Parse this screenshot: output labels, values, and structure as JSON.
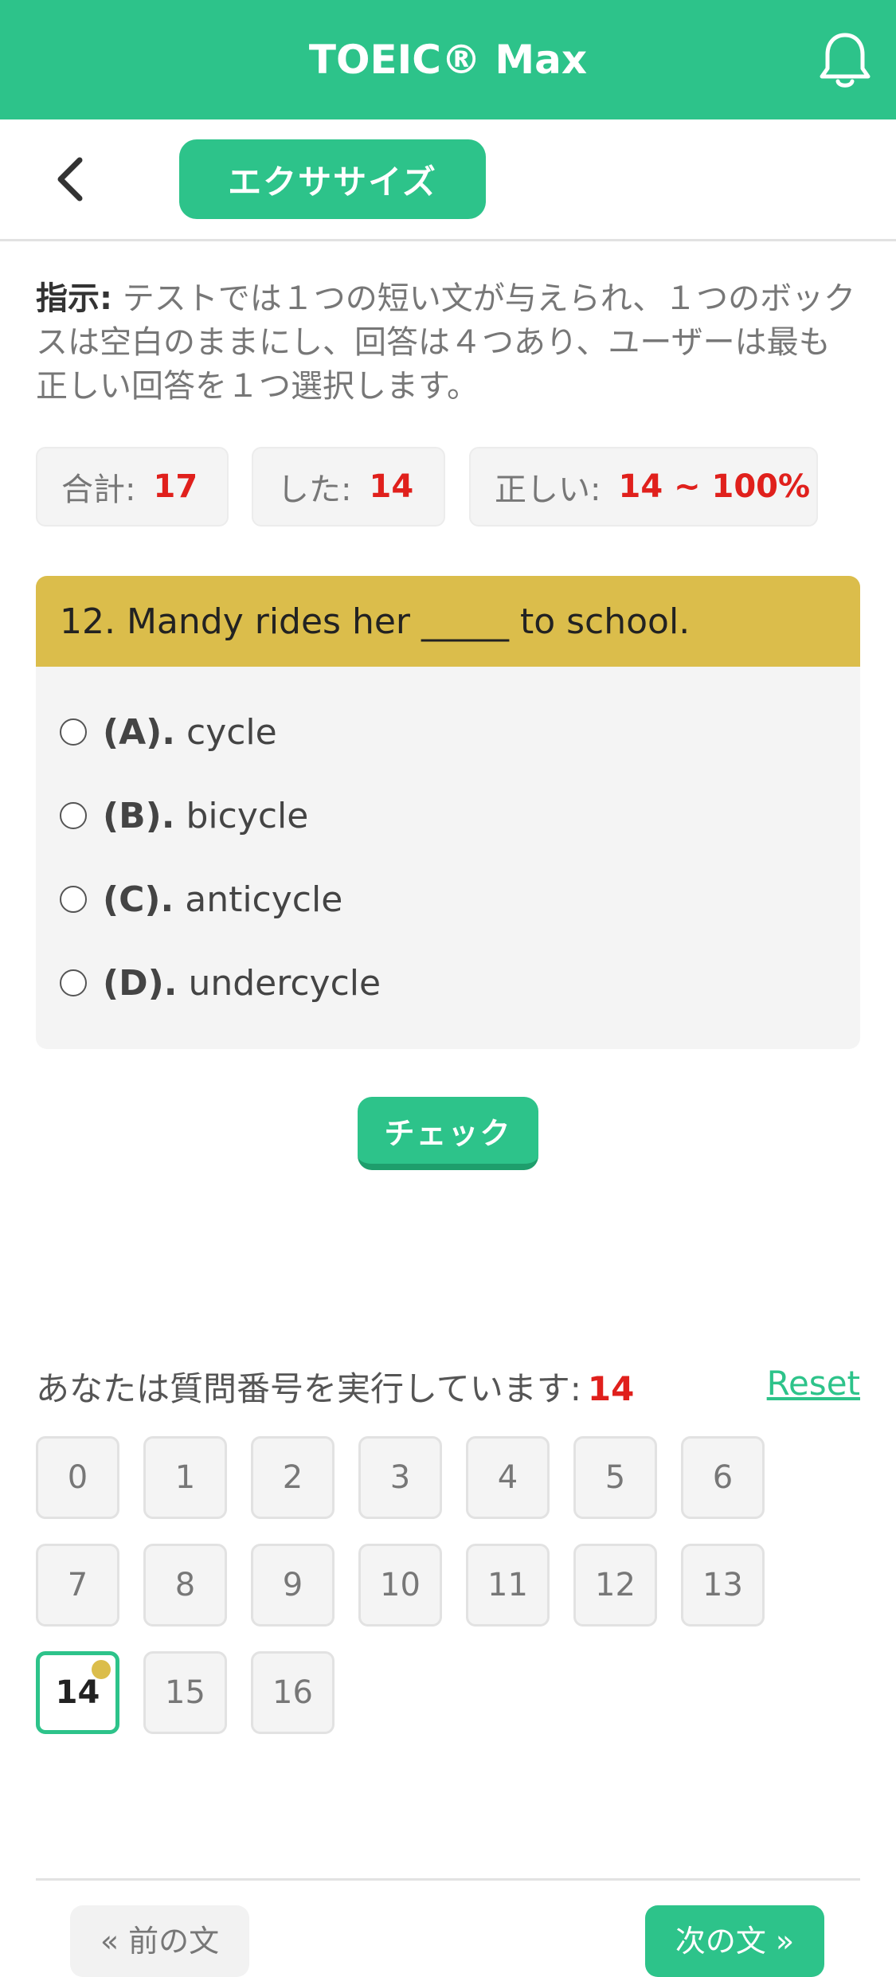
{
  "app": {
    "title": "TOEIC® Max"
  },
  "subbar": {
    "tab_label": "エクササイズ"
  },
  "instructions": {
    "label": "指示:",
    "text": " テストでは１つの短い文が与えられ、１つのボックスは空白のままにし、回答は４つあり、ユーザーは最も正しい回答を１つ選択します。"
  },
  "stats": {
    "total_label": "合計:",
    "total_value": "17",
    "done_label": "した:",
    "done_value": "14",
    "correct_label": "正しい:",
    "correct_value": "14 ~ 100%"
  },
  "question": {
    "text": "12. Mandy rides her _____ to school.",
    "options": [
      {
        "letter": "(A).",
        "text": "cycle"
      },
      {
        "letter": "(B).",
        "text": "bicycle"
      },
      {
        "letter": "(C).",
        "text": "anticycle"
      },
      {
        "letter": "(D).",
        "text": "undercycle"
      }
    ]
  },
  "check_label": "チェック",
  "progress": {
    "label": "あなたは質問番号を実行しています:",
    "current": "14",
    "reset_label": "Reset"
  },
  "numbers": [
    "0",
    "1",
    "2",
    "3",
    "4",
    "5",
    "6",
    "7",
    "8",
    "9",
    "10",
    "11",
    "12",
    "13",
    "14",
    "15",
    "16"
  ],
  "current_index": 14,
  "nav": {
    "prev_label": "« 前の文",
    "next_label": "次の文 »"
  },
  "colors": {
    "brand": "#2dc38a",
    "accent": "#dbbd4b",
    "highlight": "#e0201c"
  },
  "icons": {
    "notification": "bell-icon",
    "back": "chevron-left-icon"
  }
}
